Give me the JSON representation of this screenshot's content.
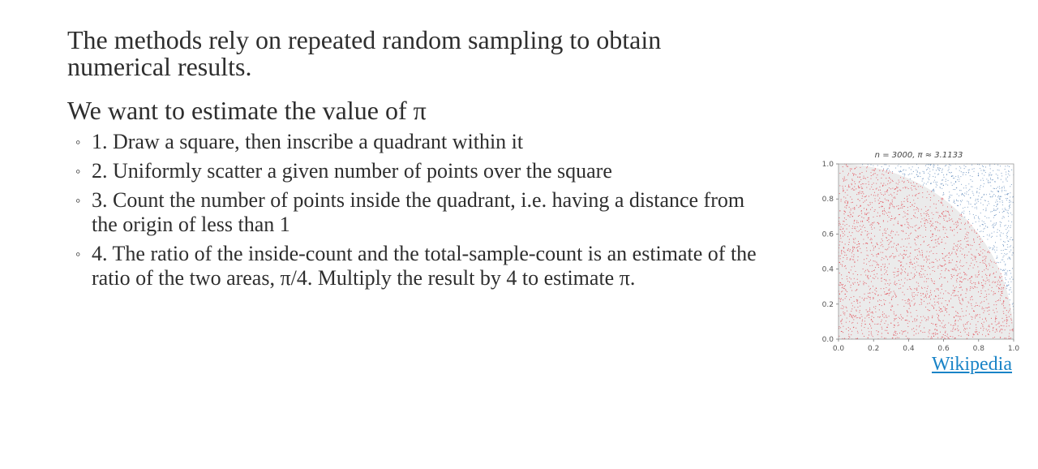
{
  "intro": "The methods rely on repeated random sampling to obtain numerical results.",
  "subhead": "We want to estimate the value of π",
  "steps": [
    {
      "text": "1. Draw a square, then inscribe a quadrant within it"
    },
    {
      "text": "2. Uniformly scatter a given number of points over the square"
    },
    {
      "text": "3. Count the number of points inside the quadrant, i.e. having a distance from the origin of less than 1"
    },
    {
      "text": "4. The ratio of the inside-count and the total-sample-count is an estimate of the ratio of the two areas, π/4. Multiply the result by 4 to estimate π."
    }
  ],
  "link_label": "Wikipedia",
  "chart_data": {
    "type": "scatter",
    "title": "n = 3000, π ≈ 3.1133",
    "n": 3000,
    "pi_estimate": 3.1133,
    "xlim": [
      0,
      1
    ],
    "ylim": [
      0,
      1
    ],
    "xticks": [
      "0.0",
      "0.2",
      "0.4",
      "0.6",
      "0.8",
      "1.0"
    ],
    "yticks": [
      "0.0",
      "0.2",
      "0.4",
      "0.6",
      "0.8",
      "1.0"
    ],
    "quadrant_radius": 1,
    "series": [
      {
        "color": "#e0404a",
        "region": "inside"
      },
      {
        "color": "#5b86b8",
        "region": "outside"
      }
    ],
    "quadrant_fill": "#ebebeb",
    "grid": false
  }
}
